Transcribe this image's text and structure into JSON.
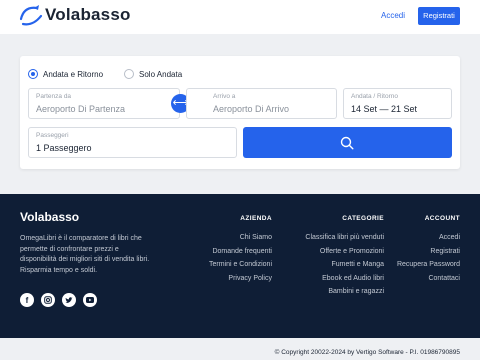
{
  "header": {
    "brand": "Volabasso",
    "login": "Accedi",
    "signup": "Registrati"
  },
  "search": {
    "trip_types": [
      "Andata e Ritorno",
      "Solo Andata"
    ],
    "selected_trip_type": "Andata e Ritorno",
    "from": {
      "label": "Partenza da",
      "placeholder": "Aeroporto Di Partenza"
    },
    "to": {
      "label": "Arrivo a",
      "placeholder": "Aeroporto Di Arrivo"
    },
    "dates": {
      "label": "Andata / Ritorno",
      "value": "14 Set — 21 Set"
    },
    "passengers": {
      "label": "Passeggeri",
      "value": "1 Passeggero"
    }
  },
  "footer": {
    "brand": "Volabasso",
    "description": "OmegaLibri è il comparatore di libri che permette di confrontare prezzi e disponibilità dei migliori siti di vendita libri. Risparmia tempo e soldi.",
    "socials": [
      "facebook-icon",
      "instagram-icon",
      "twitter-icon",
      "youtube-icon"
    ],
    "columns": {
      "azienda": {
        "title": "AZIENDA",
        "links": [
          "Chi Siamo",
          "Domande frequenti",
          "Termini e Condizioni",
          "Privacy Policy"
        ]
      },
      "categorie": {
        "title": "CATEGORIE",
        "links": [
          "Classifica libri più venduti",
          "Offerte e Promozioni",
          "Fumetti e Manga",
          "Ebook ed Audio libri",
          "Bambini e ragazzi"
        ]
      },
      "account": {
        "title": "ACCOUNT",
        "links": [
          "Accedi",
          "Registrati",
          "Recupera Password",
          "Contattaci"
        ]
      }
    }
  },
  "copyright": "© Copyright 20022-2024 by Vertigo Software - P.I. 01986790895",
  "colors": {
    "primary": "#2563eb",
    "footer_bg": "#0f1e36",
    "page_bg": "#eef0f3"
  }
}
